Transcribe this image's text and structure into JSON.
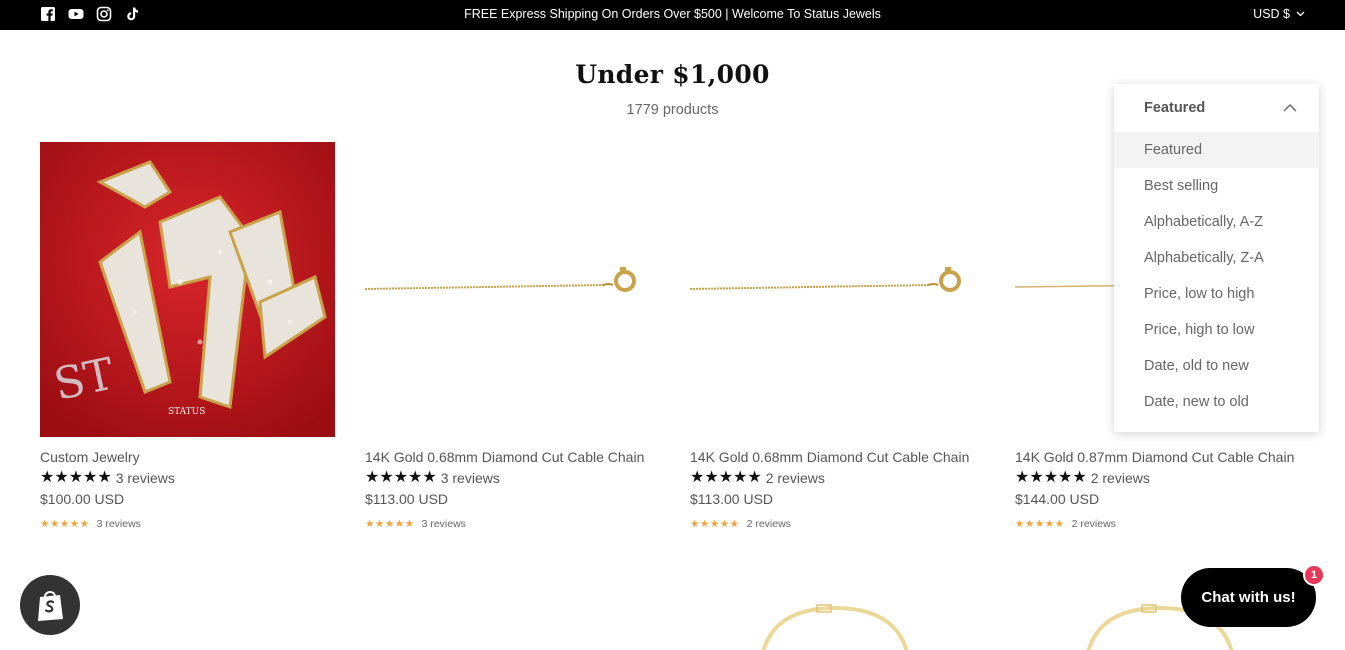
{
  "announcement": {
    "text": "FREE Express Shipping On Orders Over $500 | Welcome To Status Jewels"
  },
  "currency": {
    "label": "USD $"
  },
  "social": [
    "facebook-icon",
    "youtube-icon",
    "instagram-icon",
    "tiktok-icon"
  ],
  "collection": {
    "title": "Under $1,000",
    "count": "1779 products"
  },
  "products": [
    {
      "title": "Custom Jewelry",
      "reviews": "3 reviews",
      "price": "$100.00 USD",
      "rating": 5,
      "mini_reviews": "3 reviews"
    },
    {
      "title": "14K Gold 0.68mm Diamond Cut Cable Chain",
      "reviews": "3 reviews",
      "price": "$113.00 USD",
      "rating": 5,
      "mini_reviews": "3 reviews"
    },
    {
      "title": "14K Gold 0.68mm Diamond Cut Cable Chain",
      "reviews": "2 reviews",
      "price": "$113.00 USD",
      "rating": 5,
      "mini_reviews": "2 reviews"
    },
    {
      "title": "14K Gold 0.87mm Diamond Cut Cable Chain",
      "reviews": "2 reviews",
      "price": "$144.00 USD",
      "rating": 5,
      "mini_reviews": "2 reviews"
    }
  ],
  "sort": {
    "selected": "Featured",
    "options": [
      "Featured",
      "Best selling",
      "Alphabetically, A-Z",
      "Alphabetically, Z-A",
      "Price, low to high",
      "Price, high to low",
      "Date, old to new",
      "Date, new to old"
    ]
  },
  "chat": {
    "label": "Chat with us!",
    "badge": "1"
  },
  "colors": {
    "topbar": "#000000",
    "star": "#111111",
    "mini_star": "#f0a43a",
    "chat_badge": "#e8385a",
    "product_red": "#c8161d"
  }
}
